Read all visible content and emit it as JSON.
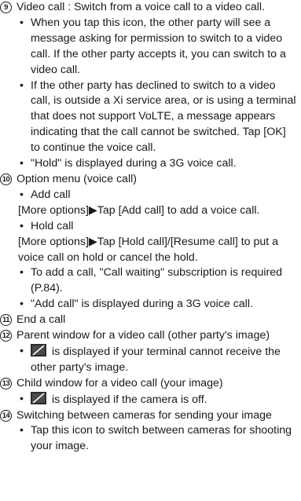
{
  "items": [
    {
      "num": "9",
      "title": "Video call : Switch from a voice call to a video call.",
      "bullets": [
        "When you tap this icon, the other party will see a message asking for permission to switch to a video call. If the other party accepts it, you can switch to a video call.",
        "If the other party has declined to switch to a video call, is outside a Xi service area, or is using a terminal that does not support VoLTE, a message appears indicating that the call cannot be switched. Tap [OK] to continue the voice call.",
        "\"Hold\" is displayed during a 3G voice call."
      ]
    },
    {
      "num": "10",
      "title": "Option menu (voice call)",
      "bullets_detail": [
        {
          "label": "Add call",
          "detail": "[More options]▶Tap [Add call] to add a voice call."
        },
        {
          "label": "Hold call",
          "detail": "[More options]▶Tap [Hold call]/[Resume call] to put a voice call on hold or cancel the hold."
        }
      ],
      "bullets": [
        "To add a call, \"Call waiting\" subscription is required (P.84).",
        "\"Add call\" is displayed during a 3G voice call."
      ]
    },
    {
      "num": "11",
      "title": "End a call"
    },
    {
      "num": "12",
      "title": "Parent window for a video call (other party's image)",
      "bullet_icon_text": "is displayed if your terminal cannot receive the other party's image."
    },
    {
      "num": "13",
      "title": "Child window for a video call (your image)",
      "bullet_icon_text": "is displayed if the camera is off."
    },
    {
      "num": "14",
      "title": "Switching between cameras for sending your image",
      "bullets": [
        "Tap this icon to switch between cameras for shooting your image."
      ]
    }
  ],
  "bullet_symbol": "•",
  "icon": "camera-off-icon",
  "colors": {
    "text": "#1a1a1a",
    "icon_bg": "#2b2b2b"
  }
}
